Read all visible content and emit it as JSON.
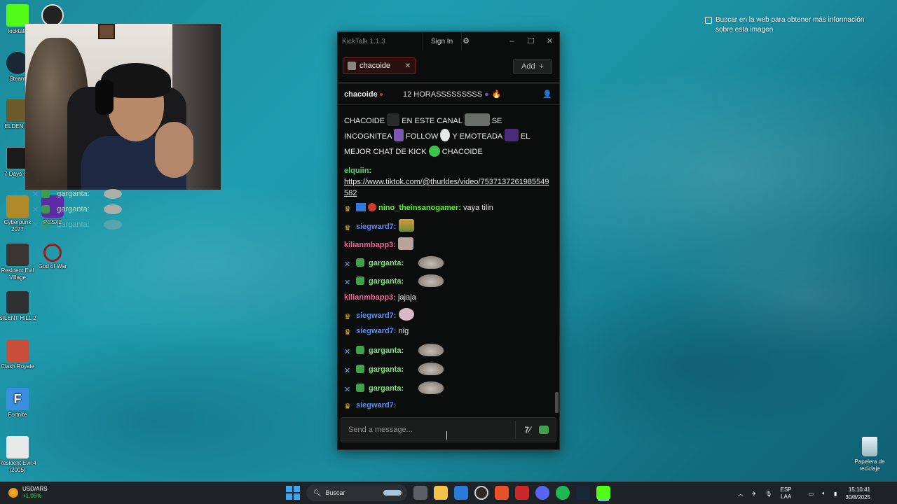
{
  "desktop": {
    "icons": [
      {
        "label": "kicktalk",
        "color": "#53fc18"
      },
      {
        "label": "Steam",
        "color": "#1b2838"
      },
      {
        "label": "ELDEN RI",
        "color": "#6b5a2a"
      },
      {
        "label": "7 Days Go",
        "color": "#1a1a1a"
      },
      {
        "label": "Cyberpunk 2077",
        "color": "#b08a28"
      },
      {
        "label": "Resident Evil Village",
        "color": "#3a3432"
      },
      {
        "label": "God of War",
        "color": "#9a1a1a"
      },
      {
        "label": "SILENT HILL 2",
        "color": "#2f3032"
      },
      {
        "label": "Clash Royale",
        "color": "#c8503a"
      },
      {
        "label": "Fortnite",
        "color": "#3a8fe0"
      },
      {
        "label": "Resident Evil 4 (2005)",
        "color": "#e8e8e8"
      },
      {
        "label": "PCSX2",
        "color": "#5d2aa8"
      }
    ],
    "recycle_bin": "Papelera de reciclaje",
    "lens_hint": "Buscar en la web para obtener más información sobre esta imagen"
  },
  "overlay_chat": [
    {
      "user": "garganta:"
    },
    {
      "user": "garganta:"
    },
    {
      "user": "garganta:"
    }
  ],
  "kicktalk": {
    "title": "KickTalk 1.1.3",
    "sign_in": "Sign In",
    "tab_label": "chacoide",
    "add_label": "Add",
    "channel": "chacoide",
    "stream_title": "12 HORASSSSSSSSS",
    "input_placeholder": "Send a message...",
    "messages": [
      {
        "text_a": "CHACOIDE",
        "text_b": "EN ESTE CANAL",
        "text_c": "SE"
      },
      {
        "text_a": "INCOGNITEA",
        "text_b": "FOLLOW",
        "text_c": "Y EMOTEADA",
        "text_d": "EL"
      },
      {
        "text_a": "MEJOR CHAT DE KICK",
        "text_b": "CHACOIDE"
      },
      {
        "user": "elquiin:",
        "link": "https://www.tiktok.com/@thurldes/video/7537137261985549582"
      },
      {
        "user": "nino_theinsanogamer:",
        "text": "vaya tilin"
      },
      {
        "user": "siegward7:"
      },
      {
        "user": "kilianmbapp3:"
      },
      {
        "user": "garganta:"
      },
      {
        "user": "garganta:"
      },
      {
        "user": "kilianmbapp3:",
        "text": "jajaja"
      },
      {
        "user": "siegward7:"
      },
      {
        "user": "siegward7:",
        "text": "nig"
      },
      {
        "user": "garganta:"
      },
      {
        "user": "garganta:"
      },
      {
        "user": "garganta:"
      },
      {
        "user": "siegward7:"
      }
    ],
    "colors": {
      "elquiin": "#53d66a",
      "nino": "#53fc18",
      "siegward": "#5b8cf0",
      "kilian": "#f0629a",
      "garganta": "#7fe37a"
    }
  },
  "taskbar": {
    "widget_title": "USD/ARS",
    "widget_value": "+1,05%",
    "search": "Buscar",
    "lang_1": "ESP",
    "lang_2": "LAA",
    "time": "15:10:41",
    "date": "30/8/2025"
  }
}
